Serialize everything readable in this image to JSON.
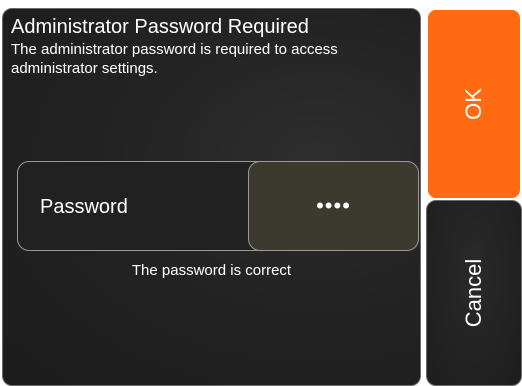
{
  "dialog": {
    "title": "Administrator Password Required",
    "description": "The administrator password is required to access administrator settings."
  },
  "password": {
    "label": "Password",
    "masked_value": "••••",
    "status": "The password is correct"
  },
  "buttons": {
    "ok_label": "OK",
    "cancel_label": "Cancel"
  },
  "colors": {
    "accent": "#ff6a12",
    "panel_background": "#232323",
    "field_background": "#3c3a2e"
  }
}
